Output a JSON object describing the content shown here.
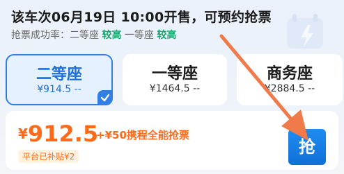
{
  "sale_notice": "该车次06月19日 10:00开售，可预约抢票",
  "success_rate": {
    "label": "抢票成功率：",
    "items": [
      {
        "seat": "二等座",
        "level": "较高"
      },
      {
        "seat": "一等座",
        "level": "较高"
      }
    ]
  },
  "seats": [
    {
      "name": "二等座",
      "price": "¥914.5",
      "remain": "--",
      "selected": true
    },
    {
      "name": "一等座",
      "price": "¥1464.5",
      "remain": "--",
      "selected": false
    },
    {
      "name": "商务座",
      "price": "¥2884.5",
      "remain": "--",
      "selected": false
    }
  ],
  "booking": {
    "currency": "¥",
    "price": "912.5",
    "promo": "+¥50携程全能抢票",
    "subsidy": "平台已补贴¥2",
    "grab_label": "抢"
  },
  "colors": {
    "accent": "#2f7fe6",
    "price_orange": "#ff6a1a",
    "rate_green": "#1aa36b",
    "arrow": "#f07a4a"
  },
  "icons": [
    "lightning-icon",
    "checkmark-icon",
    "arrow-annotation"
  ]
}
